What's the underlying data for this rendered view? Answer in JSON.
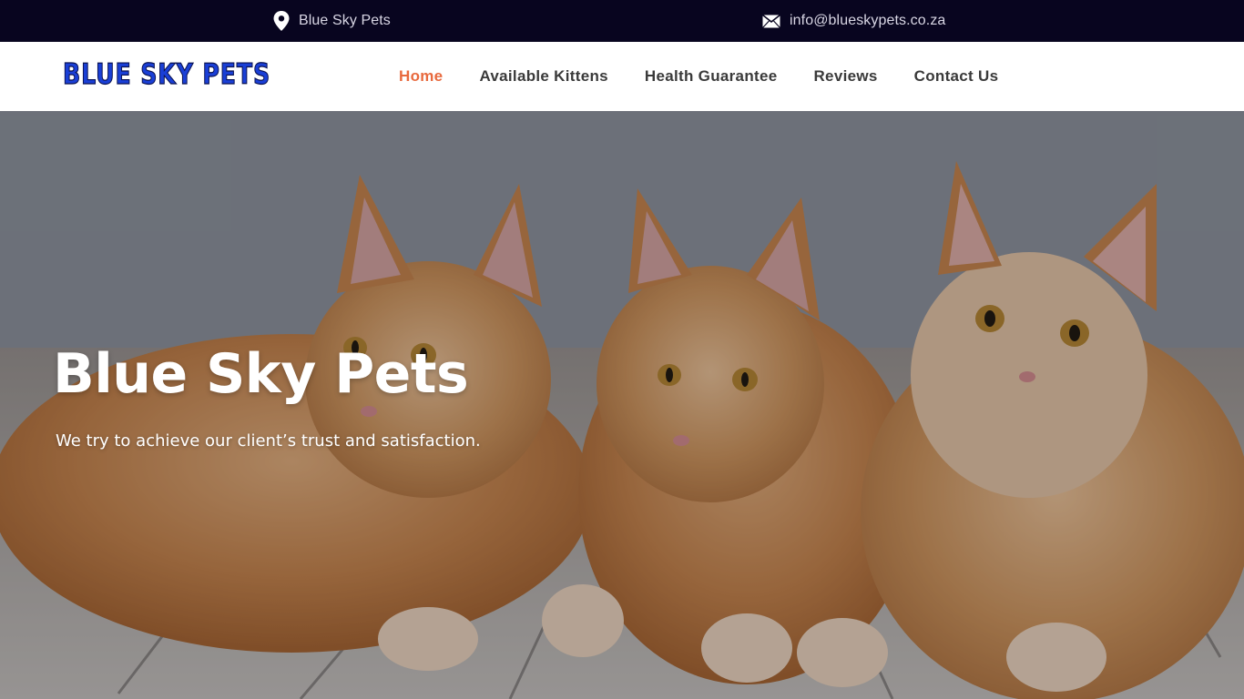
{
  "topbar": {
    "location_text": "Blue Sky Pets",
    "location_icon": "map-pin-icon",
    "email_text": "info@blueskypets.co.za",
    "email_icon": "envelope-icon"
  },
  "header": {
    "logo_text": "BLUE SKY PETS",
    "nav": [
      {
        "label": "Home",
        "active": true
      },
      {
        "label": "Available Kittens",
        "active": false
      },
      {
        "label": "Health Guarantee",
        "active": false
      },
      {
        "label": "Reviews",
        "active": false
      },
      {
        "label": "Contact Us",
        "active": false
      }
    ]
  },
  "hero": {
    "title": "Blue Sky Pets",
    "subtitle": "We try to achieve our client’s trust and satisfaction.",
    "image_alt": "three orange kittens lying on wooden floor"
  },
  "colors": {
    "topbar_bg": "#08051f",
    "accent": "#e8693d",
    "nav_text": "#3a3a3a",
    "logo_blue": "#1a3fd6"
  }
}
